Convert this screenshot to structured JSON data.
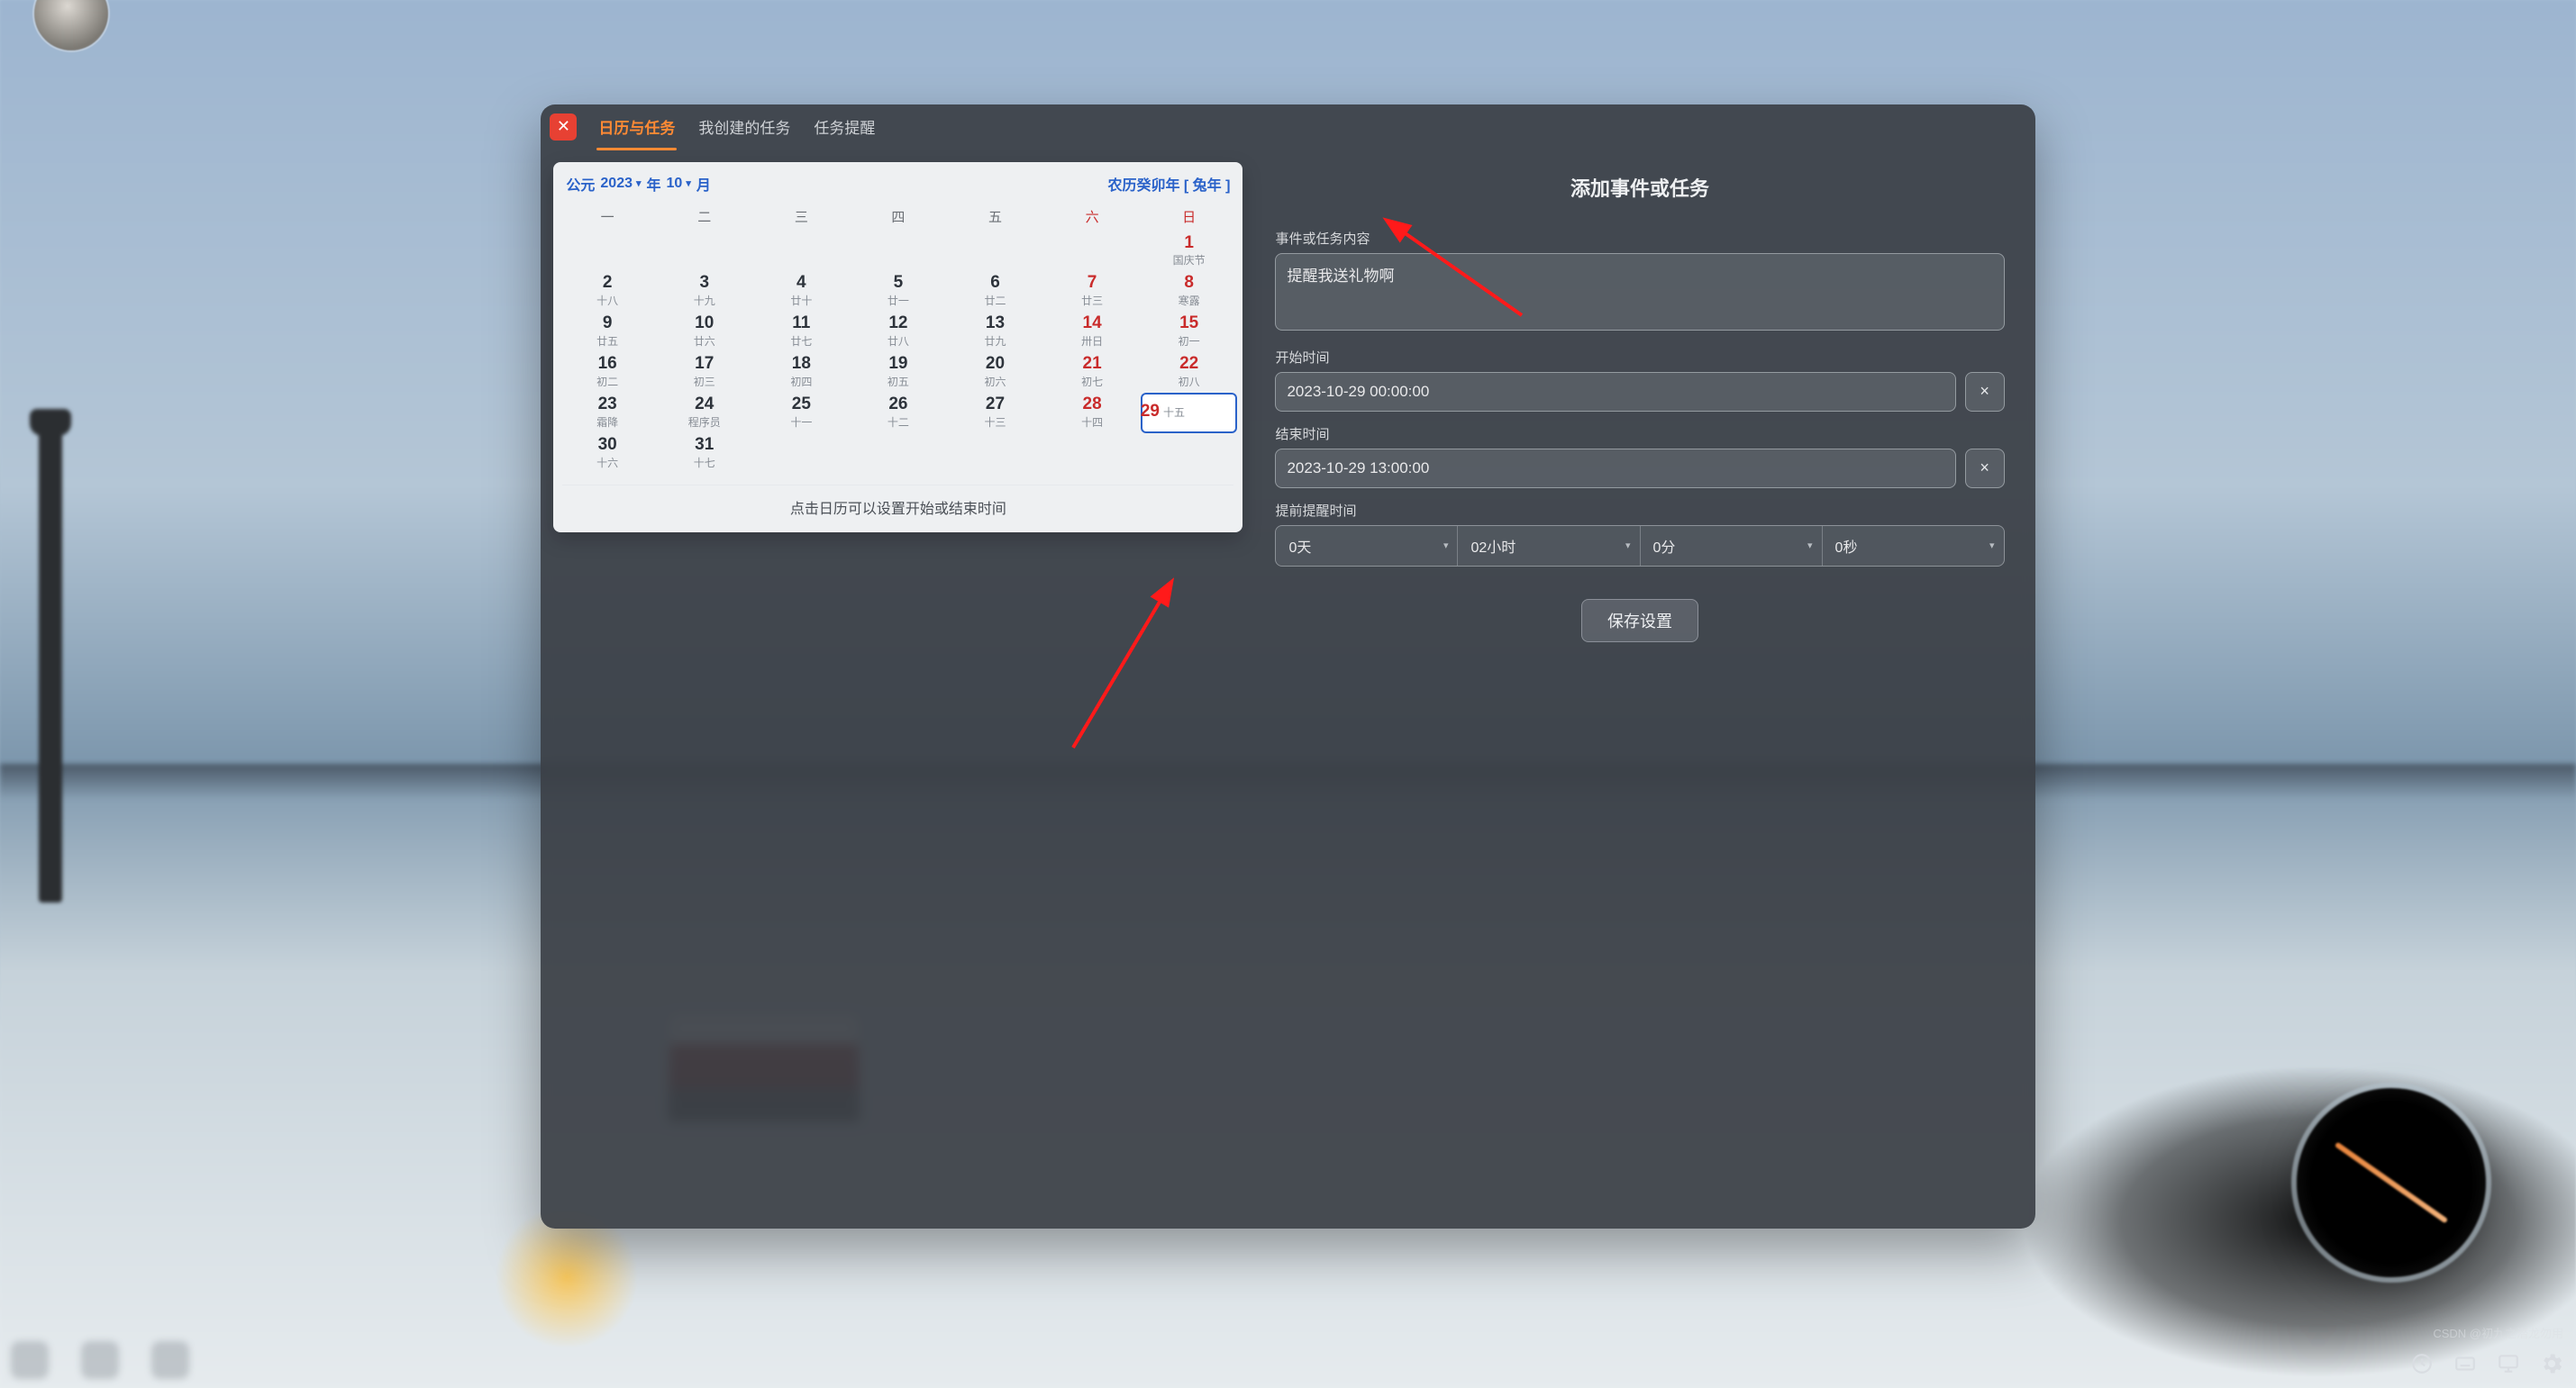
{
  "tabs": {
    "calendar": "日历与任务",
    "mine": "我创建的任务",
    "alerts": "任务提醒"
  },
  "calendar": {
    "era": "公元",
    "year": "2023",
    "year_suffix": "年",
    "month": "10",
    "month_suffix": "月",
    "lunar_year": "农历癸卯年 [ 兔年 ]",
    "weekdays": [
      "一",
      "二",
      "三",
      "四",
      "五",
      "六",
      "日"
    ],
    "weeks": [
      [
        null,
        null,
        null,
        null,
        null,
        null,
        {
          "n": "1",
          "s": "国庆节",
          "wk": true
        }
      ],
      [
        {
          "n": "2",
          "s": "十八",
          "wk": false
        },
        {
          "n": "3",
          "s": "十九",
          "wk": false
        },
        {
          "n": "4",
          "s": "廿十",
          "wk": false
        },
        {
          "n": "5",
          "s": "廿一",
          "wk": false
        },
        {
          "n": "6",
          "s": "廿二",
          "wk": false
        },
        {
          "n": "7",
          "s": "廿三",
          "wk": true
        },
        {
          "n": "8",
          "s": "寒露",
          "wk": true
        }
      ],
      [
        {
          "n": "9",
          "s": "廿五",
          "wk": false
        },
        {
          "n": "10",
          "s": "廿六",
          "wk": false
        },
        {
          "n": "11",
          "s": "廿七",
          "wk": false
        },
        {
          "n": "12",
          "s": "廿八",
          "wk": false
        },
        {
          "n": "13",
          "s": "廿九",
          "wk": false
        },
        {
          "n": "14",
          "s": "卅日",
          "wk": true
        },
        {
          "n": "15",
          "s": "初一",
          "wk": true
        }
      ],
      [
        {
          "n": "16",
          "s": "初二",
          "wk": false
        },
        {
          "n": "17",
          "s": "初三",
          "wk": false
        },
        {
          "n": "18",
          "s": "初四",
          "wk": false
        },
        {
          "n": "19",
          "s": "初五",
          "wk": false
        },
        {
          "n": "20",
          "s": "初六",
          "wk": false
        },
        {
          "n": "21",
          "s": "初七",
          "wk": true
        },
        {
          "n": "22",
          "s": "初八",
          "wk": true
        }
      ],
      [
        {
          "n": "23",
          "s": "霜降",
          "wk": false
        },
        {
          "n": "24",
          "s": "程序员",
          "wk": false
        },
        {
          "n": "25",
          "s": "十一",
          "wk": false
        },
        {
          "n": "26",
          "s": "十二",
          "wk": false
        },
        {
          "n": "27",
          "s": "十三",
          "wk": false
        },
        {
          "n": "28",
          "s": "十四",
          "wk": true
        },
        {
          "n": "29",
          "s": "十五",
          "wk": true,
          "sel": true
        }
      ],
      [
        {
          "n": "30",
          "s": "十六",
          "wk": false
        },
        {
          "n": "31",
          "s": "十七",
          "wk": false
        },
        null,
        null,
        null,
        null,
        null
      ]
    ],
    "hint": "点击日历可以设置开始或结束时间"
  },
  "form": {
    "title": "添加事件或任务",
    "content_label": "事件或任务内容",
    "content_value": "提醒我送礼物啊",
    "start_label": "开始时间",
    "start_value": "2023-10-29 00:00:00",
    "end_label": "结束时间",
    "end_value": "2023-10-29 13:00:00",
    "reminder_label": "提前提醒时间",
    "reminder": {
      "days": "0天",
      "hours": "02小时",
      "minutes": "0分",
      "seconds": "0秒"
    },
    "save": "保存设置",
    "clear_icon": "×"
  },
  "watermark": "CSDN @初九之潜龙勿用"
}
